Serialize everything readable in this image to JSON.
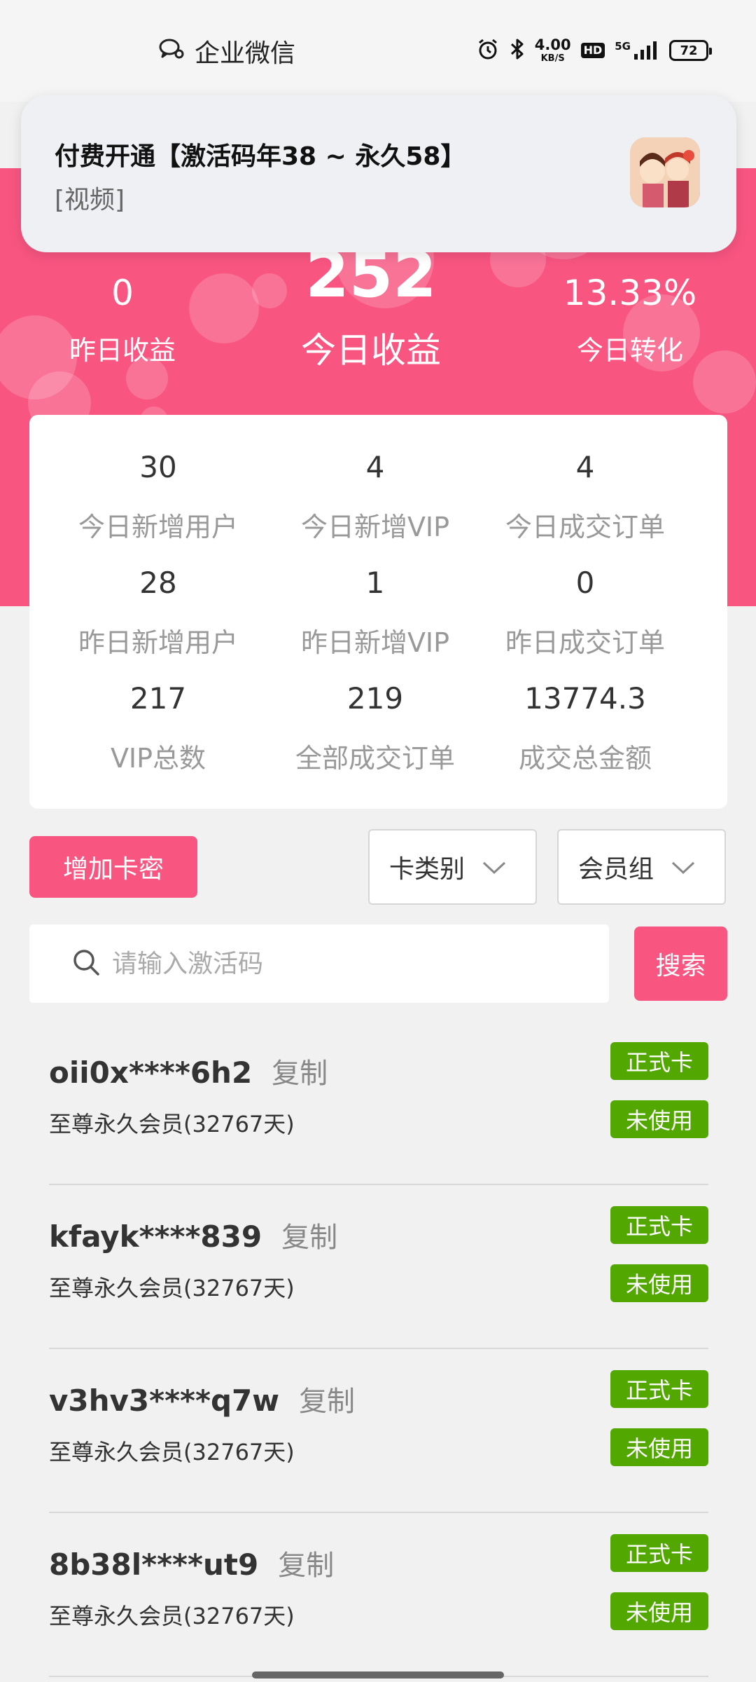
{
  "status_bar": {
    "app_name": "企业微信",
    "net_speed_value": "4.00",
    "net_speed_unit": "KB/S",
    "hd_label": "HD",
    "network": "5G",
    "battery": "72"
  },
  "notification": {
    "title": "付费开通【激活码年38 ~ 永久58】",
    "subtitle": "[视频]"
  },
  "hero": {
    "yesterday_income": {
      "value": "0",
      "label": "昨日收益"
    },
    "today_income": {
      "value": "252",
      "label": "今日收益"
    },
    "today_conversion": {
      "value": "13.33%",
      "label": "今日转化"
    }
  },
  "stats": [
    {
      "value": "30",
      "label": "今日新增用户"
    },
    {
      "value": "4",
      "label": "今日新增VIP"
    },
    {
      "value": "4",
      "label": "今日成交订单"
    },
    {
      "value": "28",
      "label": "昨日新增用户"
    },
    {
      "value": "1",
      "label": "昨日新增VIP"
    },
    {
      "value": "0",
      "label": "昨日成交订单"
    },
    {
      "value": "217",
      "label": "VIP总数"
    },
    {
      "value": "219",
      "label": "全部成交订单"
    },
    {
      "value": "13774.3",
      "label": "成交总金额"
    }
  ],
  "controls": {
    "add_button": "增加卡密",
    "card_type_dropdown": "卡类别",
    "member_group_dropdown": "会员组",
    "search_placeholder": "请输入激活码",
    "search_button": "搜索"
  },
  "cards": [
    {
      "code": "oii0x****6h2",
      "copy": "复制",
      "desc": "至尊永久会员(32767天)",
      "type": "正式卡",
      "status": "未使用"
    },
    {
      "code": "kfayk****839",
      "copy": "复制",
      "desc": "至尊永久会员(32767天)",
      "type": "正式卡",
      "status": "未使用"
    },
    {
      "code": "v3hv3****q7w",
      "copy": "复制",
      "desc": "至尊永久会员(32767天)",
      "type": "正式卡",
      "status": "未使用"
    },
    {
      "code": "8b38l****ut9",
      "copy": "复制",
      "desc": "至尊永久会员(32767天)",
      "type": "正式卡",
      "status": "未使用"
    }
  ],
  "colors": {
    "brand_pink": "#f85581",
    "tag_green": "#52a800"
  }
}
